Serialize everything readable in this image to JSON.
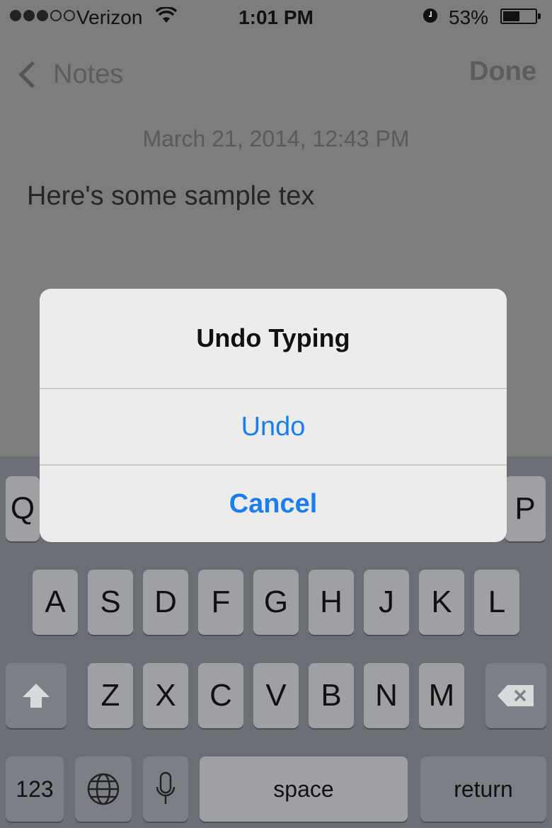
{
  "status_bar": {
    "carrier": "Verizon",
    "time": "1:01 PM",
    "battery": "53%",
    "signal_bars": 3,
    "signal_max": 5,
    "battery_fraction": 0.53
  },
  "nav": {
    "back_label": "Notes",
    "done_label": "Done"
  },
  "note": {
    "date": "March 21, 2014, 12:43 PM",
    "body": "Here's some sample tex"
  },
  "alert": {
    "title": "Undo Typing",
    "undo_label": "Undo",
    "cancel_label": "Cancel"
  },
  "keyboard": {
    "row1_left": "Q",
    "row1_right": "P",
    "row2": [
      "A",
      "S",
      "D",
      "F",
      "G",
      "H",
      "J",
      "K",
      "L"
    ],
    "row3": [
      "Z",
      "X",
      "C",
      "V",
      "B",
      "N",
      "M"
    ],
    "numbers_label": "123",
    "space_label": "space",
    "return_label": "return"
  },
  "colors": {
    "accent": "#1a7ef0",
    "dim_overlay": "#7d7d7d",
    "keyboard_bg": "#6b6e74"
  }
}
